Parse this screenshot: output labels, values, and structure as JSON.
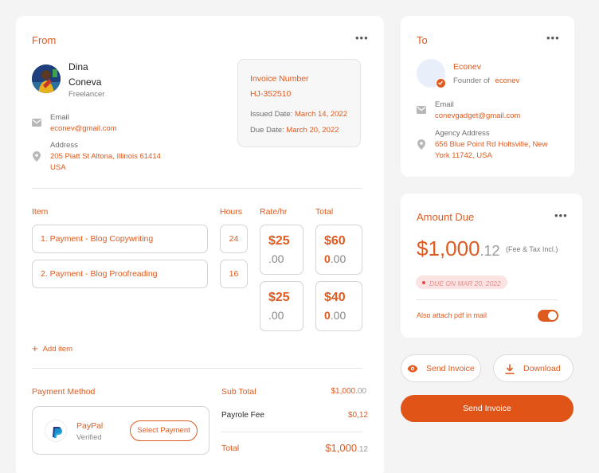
{
  "from": {
    "title": "From",
    "first_name": "Dina",
    "last_name": "Coneva",
    "role": "Freelancer",
    "email_label": "Email",
    "email": "econev@gmail.com",
    "address_label": "Address",
    "address_line1": "205 Piatt St Altona, Illinois 61414",
    "address_line2": "USA"
  },
  "invoice": {
    "number_label": "Invoice Number",
    "number": "HJ-352510",
    "issued_label": "Issued Date:",
    "issued_date": "March 14, 2022",
    "due_label": "Due Date:",
    "due_date": "March 20, 2022"
  },
  "items_table": {
    "headers": {
      "item": "Item",
      "hours": "Hours",
      "rate": "Rate/hr",
      "total": "Total"
    },
    "rows": [
      {
        "name": "1. Payment - Blog Copywriting",
        "hours": "24",
        "rate_main": "$25",
        "rate_cents": ".00",
        "total_main": "$60",
        "total_zero": "0",
        "total_cents": ".00"
      },
      {
        "name": "2. Payment - Blog Proofreading",
        "hours": "16",
        "rate_main": "$25",
        "rate_cents": ".00",
        "total_main": "$40",
        "total_zero": "0",
        "total_cents": ".00"
      }
    ],
    "add_item": "Add item"
  },
  "payment": {
    "title": "Payment Method",
    "method_name": "PayPal",
    "method_status": "Verified",
    "select_button": "Select Payment"
  },
  "summary": {
    "subtotal_label": "Sub Total",
    "subtotal_main": "$1,000",
    "subtotal_cents": ".00",
    "fee_label": "Payrole Fee",
    "fee_value": "$0,12",
    "total_label": "Total",
    "total_main": "$1,000",
    "total_cents": ".12"
  },
  "to": {
    "title": "To",
    "name": "Econev",
    "founder_label": "Founder of",
    "company": "econev",
    "email_label": "Email",
    "email": "conevgadget@gmail.com",
    "address_label": "Agency Address",
    "address_line1": "656 Blue Point Rd Holtsville, New",
    "address_line2": "York 11742, USA"
  },
  "amount_due": {
    "title": "Amount Due",
    "amount_main": "$1,000",
    "amount_cents": ".12",
    "fee_note": "(Fee & Tax Incl.)",
    "due_badge": "DUE ON MAR 20, 2022",
    "attach_label": "Also attach pdf in mail",
    "attach_toggle_on": true
  },
  "actions": {
    "send_outline": "Send Invoice",
    "download": "Download",
    "send_primary": "Send Invoice"
  },
  "colors": {
    "accent": "#df5a1f",
    "badge_bg": "#fbe3e3",
    "page_bg": "#f4f4f4"
  }
}
